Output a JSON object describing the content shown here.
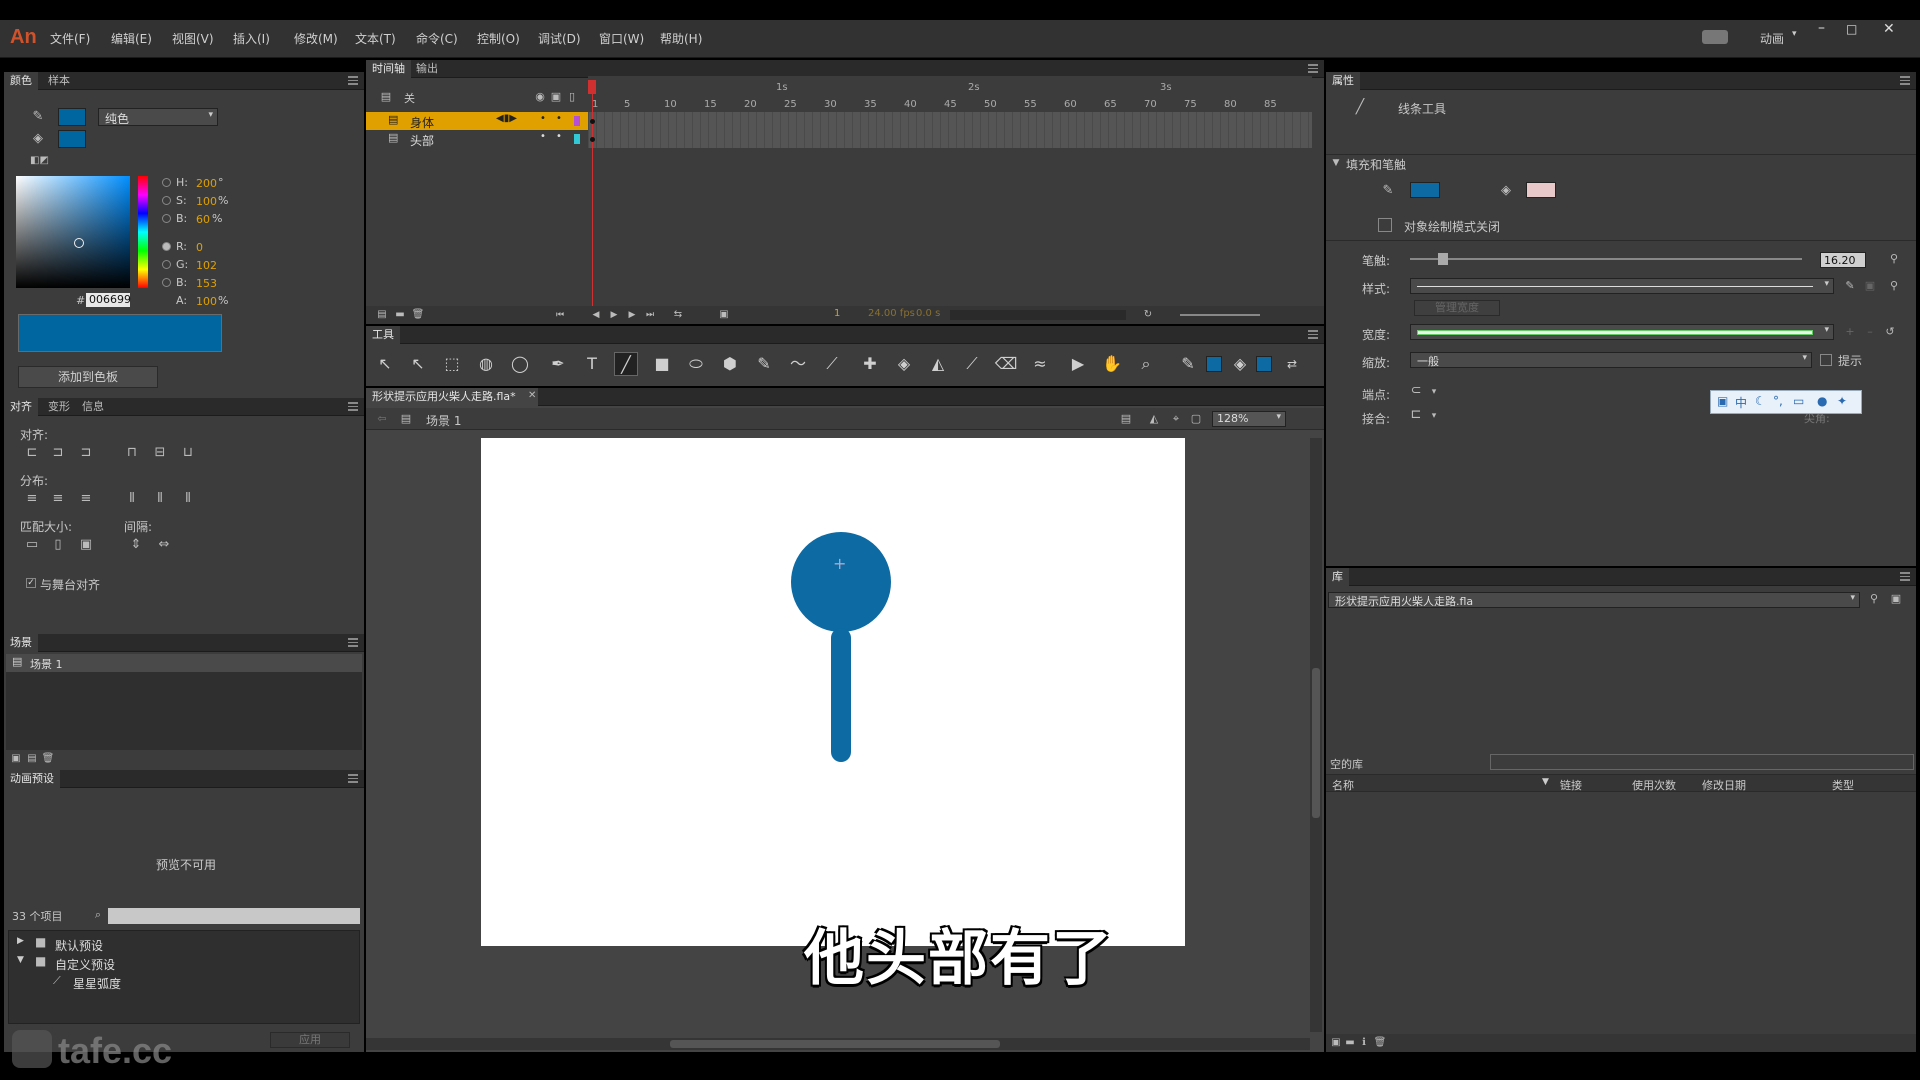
{
  "app": {
    "logo": "An",
    "workspace": "动画"
  },
  "menu": [
    "文件(F)",
    "编辑(E)",
    "视图(V)",
    "插入(I)",
    "修改(M)",
    "文本(T)",
    "命令(C)",
    "控制(O)",
    "调试(D)",
    "窗口(W)",
    "帮助(H)"
  ],
  "color_panel": {
    "tabs": [
      "颜色",
      "样本"
    ],
    "fill_type": "纯色",
    "hsb": {
      "h_label": "H:",
      "h": "200",
      "h_unit": "°",
      "s_label": "S:",
      "s": "100",
      "s_unit": "%",
      "b_label": "B:",
      "b": "60",
      "b_unit": "%"
    },
    "rgb": {
      "r_label": "R:",
      "r": "0",
      "g_label": "G:",
      "g": "102",
      "b_label": "B:",
      "b": "153"
    },
    "alpha_label": "A:",
    "alpha": "100",
    "alpha_unit": "%",
    "hex_prefix": "#",
    "hex": "006699",
    "swatch_color": "#0066a0",
    "add_button": "添加到色板"
  },
  "align_panel": {
    "tabs": [
      "对齐",
      "变形",
      "信息"
    ],
    "align_label": "对齐:",
    "distribute_label": "分布:",
    "match_size_label": "匹配大小:",
    "spacing_label": "间隔:",
    "stage_align_label": "与舞台对齐",
    "stage_align_checked": true
  },
  "scene_panel": {
    "tab": "场景",
    "items": [
      "场景 1"
    ]
  },
  "motion_presets": {
    "tab": "动画预设",
    "preview": "预览不可用",
    "count": "33 个项目",
    "tree": [
      {
        "label": "默认预设",
        "expanded": false
      },
      {
        "label": "自定义预设",
        "expanded": true
      },
      {
        "label": "星星弧度",
        "child": true
      }
    ],
    "apply": "应用"
  },
  "timeline": {
    "tabs": [
      "时间轴",
      "输出"
    ],
    "header_layer": "关",
    "layers": [
      {
        "name": "身体",
        "selected": true,
        "color": "#b44fd6"
      },
      {
        "name": "头部",
        "selected": false,
        "color": "#33c8d6"
      }
    ],
    "seconds": [
      "1s",
      "2s",
      "3s"
    ],
    "frames": [
      "1",
      "5",
      "10",
      "15",
      "20",
      "25",
      "30",
      "35",
      "40",
      "45",
      "50",
      "55",
      "60",
      "65",
      "70",
      "75",
      "80",
      "85"
    ],
    "current_frame": "1",
    "fps": "24.00 fps",
    "time": "0.0 s"
  },
  "tools_panel": {
    "tab": "工具"
  },
  "document": {
    "tab": "形状提示应用火柴人走路.fla*",
    "scene": "场景 1",
    "zoom": "128%",
    "subtitle": "他头部有了",
    "shape_color": "#0d6aa3"
  },
  "properties": {
    "tab": "属性",
    "tool_name": "线条工具",
    "section": "填充和笔触",
    "stroke_color": "#0d6aa3",
    "draw_mode": "对象绘制模式关闭",
    "stroke_label": "笔触:",
    "stroke_value": "16.20",
    "style_label": "样式:",
    "manage_widths": "管理宽度",
    "width_label": "宽度:",
    "scale_label": "缩放:",
    "scale_value": "一般",
    "hint_label": "提示",
    "cap_label": "端点:",
    "join_label": "接合:",
    "sharp_label": "尖角:",
    "ime_text": "中"
  },
  "library": {
    "tab": "库",
    "file": "形状提示应用火柴人走路.fla",
    "empty": "空的库",
    "columns": [
      "名称",
      "链接",
      "使用次数",
      "修改日期",
      "类型"
    ]
  },
  "watermark": "tafe.cc"
}
